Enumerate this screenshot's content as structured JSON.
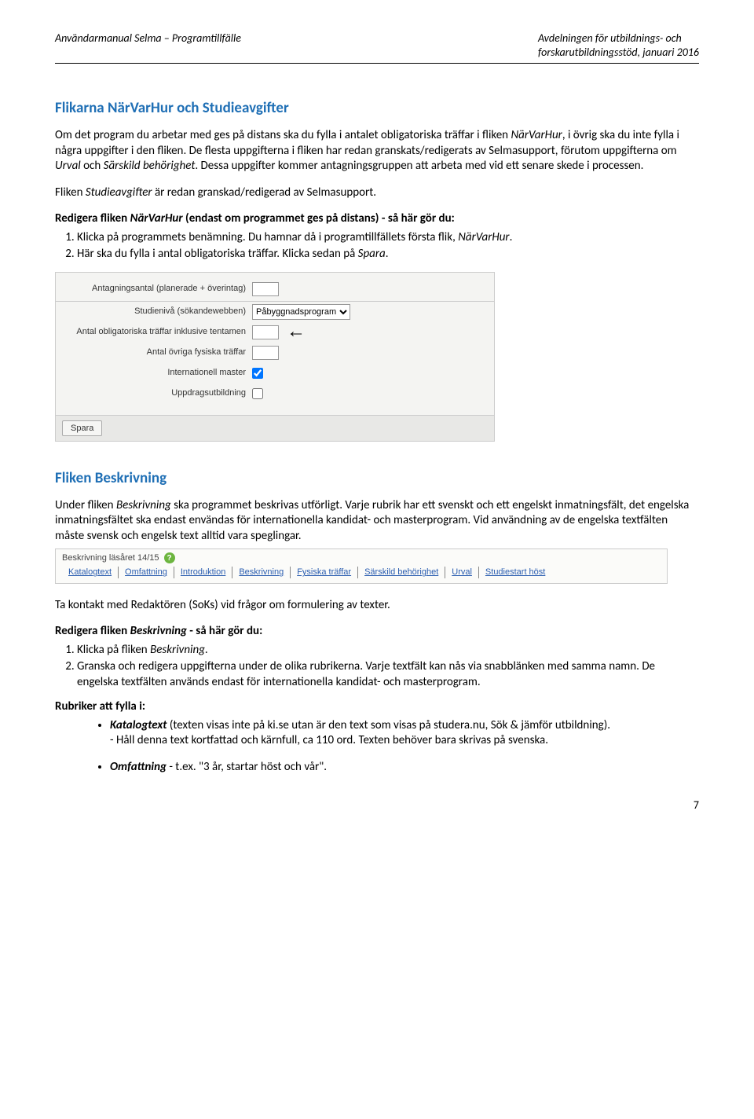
{
  "header": {
    "left": "Användarmanual Selma – Programtillfälle",
    "right_line1": "Avdelningen för utbildnings- och",
    "right_line2": "forskarutbildningsstöd, januari 2016"
  },
  "section1": {
    "heading": "Flikarna NärVarHur och Studieavgifter",
    "p1a": "Om det program du arbetar med ges på distans ska du fylla i antalet obligatoriska träffar i fliken ",
    "p1b_em": "NärVarHur",
    "p1c": ", i övrig ska du inte fylla i några uppgifter i den fliken. De flesta uppgifterna i fliken har redan granskats/redigerats av Selmasupport, förutom uppgifterna om ",
    "p1d_em": "Urval",
    "p1e": " och ",
    "p1f_em": "Särskild behörighet",
    "p1g": ". Dessa uppgifter kommer antagningsgruppen att arbeta med vid ett senare skede i processen.",
    "p2a": "Fliken ",
    "p2b_em": "Studieavgifter",
    "p2c": " är redan granskad/redigerad av Selmasupport.",
    "p3a": "Redigera fliken ",
    "p3b_em": "NärVarHur",
    "p3c": " (endast om programmet ges på distans) - så här gör du:",
    "li1a": "Klicka på programmets benämning. Du hamnar då i programtillfällets första flik, ",
    "li1b_em": "NärVarHur",
    "li1c": ".",
    "li2a": "Här ska du fylla i antal obligatoriska träffar. Klicka sedan på ",
    "li2b_em": "Spara",
    "li2c": "."
  },
  "shot1": {
    "row0_label": "Antagningsantal (planerade + överintag)",
    "row1_label": "Studienivå (sökandewebben)",
    "row1_select": "Påbyggnadsprogram",
    "row2_label": "Antal obligatoriska träffar inklusive tentamen",
    "row3_label": "Antal övriga fysiska träffar",
    "row4_label": "Internationell master",
    "row5_label": "Uppdragsutbildning",
    "spara": "Spara"
  },
  "section2": {
    "heading": "Fliken Beskrivning",
    "p1a": "Under fliken ",
    "p1b_em": "Beskrivning",
    "p1c": " ska programmet beskrivas utförligt. Varje rubrik har ett svenskt och ett engelskt inmatningsfält, det engelska inmatningsfältet ska endast envändas för internationella kandidat- och masterprogram. Vid användning av de engelska textfälten måste svensk och engelsk text alltid vara speglingar."
  },
  "shot2": {
    "title": "Beskrivning läsåret 14/15",
    "tabs": [
      "Katalogtext",
      "Omfattning",
      "Introduktion",
      "Beskrivning",
      "Fysiska träffar",
      "Särskild behörighet",
      "Urval",
      "Studiestart höst"
    ]
  },
  "section3": {
    "p1": "Ta kontakt med Redaktören (SoKs) vid frågor om formulering av texter.",
    "p2a": "Redigera fliken ",
    "p2b_em": "Beskrivning",
    "p2c": " - så här gör du:",
    "li1a": "Klicka på fliken ",
    "li1b_em": "Beskrivning",
    "li1c": ".",
    "li2": "Granska och redigera uppgifterna under de olika rubrikerna. Varje textfält kan nås via snabblänken med samma namn. De engelska textfälten används endast för internationella kandidat- och masterprogram.",
    "rubrik_title": "Rubriker att fylla i:",
    "b1a_em": "Katalogtext",
    "b1b": " (texten visas inte på ki.se utan är den text som visas på studera.nu, Sök & jämför utbildning).",
    "b1c": "- Håll denna text kortfattad och kärnfull, ca 110 ord. Texten behöver bara skrivas på svenska.",
    "b2a_em": "Omfattning",
    "b2b": " - t.ex. \"3 år, startar höst och vår\"."
  },
  "page_number": "7"
}
